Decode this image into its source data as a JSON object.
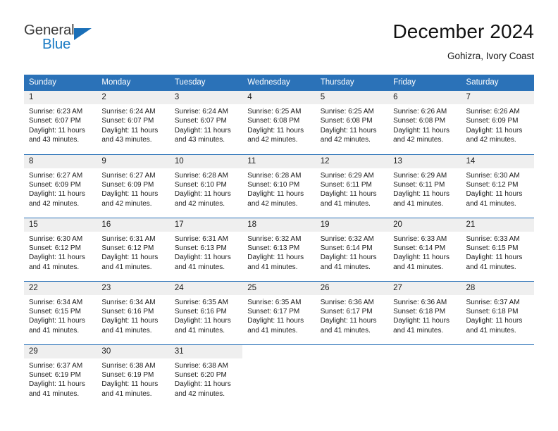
{
  "logo": {
    "word1": "General",
    "word2": "Blue",
    "triangle_color": "#1a6fb8"
  },
  "header": {
    "title": "December 2024",
    "subtitle": "Gohizra, Ivory Coast"
  },
  "theme": {
    "header_bg": "#2b72b8",
    "daynum_bg": "#efefef",
    "text": "#1b1b1b"
  },
  "calendar": {
    "weekday_headers": [
      "Sunday",
      "Monday",
      "Tuesday",
      "Wednesday",
      "Thursday",
      "Friday",
      "Saturday"
    ],
    "weeks": [
      [
        {
          "day": "1",
          "sunrise": "Sunrise: 6:23 AM",
          "sunset": "Sunset: 6:07 PM",
          "daylight1": "Daylight: 11 hours",
          "daylight2": "and 43 minutes."
        },
        {
          "day": "2",
          "sunrise": "Sunrise: 6:24 AM",
          "sunset": "Sunset: 6:07 PM",
          "daylight1": "Daylight: 11 hours",
          "daylight2": "and 43 minutes."
        },
        {
          "day": "3",
          "sunrise": "Sunrise: 6:24 AM",
          "sunset": "Sunset: 6:07 PM",
          "daylight1": "Daylight: 11 hours",
          "daylight2": "and 43 minutes."
        },
        {
          "day": "4",
          "sunrise": "Sunrise: 6:25 AM",
          "sunset": "Sunset: 6:08 PM",
          "daylight1": "Daylight: 11 hours",
          "daylight2": "and 42 minutes."
        },
        {
          "day": "5",
          "sunrise": "Sunrise: 6:25 AM",
          "sunset": "Sunset: 6:08 PM",
          "daylight1": "Daylight: 11 hours",
          "daylight2": "and 42 minutes."
        },
        {
          "day": "6",
          "sunrise": "Sunrise: 6:26 AM",
          "sunset": "Sunset: 6:08 PM",
          "daylight1": "Daylight: 11 hours",
          "daylight2": "and 42 minutes."
        },
        {
          "day": "7",
          "sunrise": "Sunrise: 6:26 AM",
          "sunset": "Sunset: 6:09 PM",
          "daylight1": "Daylight: 11 hours",
          "daylight2": "and 42 minutes."
        }
      ],
      [
        {
          "day": "8",
          "sunrise": "Sunrise: 6:27 AM",
          "sunset": "Sunset: 6:09 PM",
          "daylight1": "Daylight: 11 hours",
          "daylight2": "and 42 minutes."
        },
        {
          "day": "9",
          "sunrise": "Sunrise: 6:27 AM",
          "sunset": "Sunset: 6:09 PM",
          "daylight1": "Daylight: 11 hours",
          "daylight2": "and 42 minutes."
        },
        {
          "day": "10",
          "sunrise": "Sunrise: 6:28 AM",
          "sunset": "Sunset: 6:10 PM",
          "daylight1": "Daylight: 11 hours",
          "daylight2": "and 42 minutes."
        },
        {
          "day": "11",
          "sunrise": "Sunrise: 6:28 AM",
          "sunset": "Sunset: 6:10 PM",
          "daylight1": "Daylight: 11 hours",
          "daylight2": "and 42 minutes."
        },
        {
          "day": "12",
          "sunrise": "Sunrise: 6:29 AM",
          "sunset": "Sunset: 6:11 PM",
          "daylight1": "Daylight: 11 hours",
          "daylight2": "and 41 minutes."
        },
        {
          "day": "13",
          "sunrise": "Sunrise: 6:29 AM",
          "sunset": "Sunset: 6:11 PM",
          "daylight1": "Daylight: 11 hours",
          "daylight2": "and 41 minutes."
        },
        {
          "day": "14",
          "sunrise": "Sunrise: 6:30 AM",
          "sunset": "Sunset: 6:12 PM",
          "daylight1": "Daylight: 11 hours",
          "daylight2": "and 41 minutes."
        }
      ],
      [
        {
          "day": "15",
          "sunrise": "Sunrise: 6:30 AM",
          "sunset": "Sunset: 6:12 PM",
          "daylight1": "Daylight: 11 hours",
          "daylight2": "and 41 minutes."
        },
        {
          "day": "16",
          "sunrise": "Sunrise: 6:31 AM",
          "sunset": "Sunset: 6:12 PM",
          "daylight1": "Daylight: 11 hours",
          "daylight2": "and 41 minutes."
        },
        {
          "day": "17",
          "sunrise": "Sunrise: 6:31 AM",
          "sunset": "Sunset: 6:13 PM",
          "daylight1": "Daylight: 11 hours",
          "daylight2": "and 41 minutes."
        },
        {
          "day": "18",
          "sunrise": "Sunrise: 6:32 AM",
          "sunset": "Sunset: 6:13 PM",
          "daylight1": "Daylight: 11 hours",
          "daylight2": "and 41 minutes."
        },
        {
          "day": "19",
          "sunrise": "Sunrise: 6:32 AM",
          "sunset": "Sunset: 6:14 PM",
          "daylight1": "Daylight: 11 hours",
          "daylight2": "and 41 minutes."
        },
        {
          "day": "20",
          "sunrise": "Sunrise: 6:33 AM",
          "sunset": "Sunset: 6:14 PM",
          "daylight1": "Daylight: 11 hours",
          "daylight2": "and 41 minutes."
        },
        {
          "day": "21",
          "sunrise": "Sunrise: 6:33 AM",
          "sunset": "Sunset: 6:15 PM",
          "daylight1": "Daylight: 11 hours",
          "daylight2": "and 41 minutes."
        }
      ],
      [
        {
          "day": "22",
          "sunrise": "Sunrise: 6:34 AM",
          "sunset": "Sunset: 6:15 PM",
          "daylight1": "Daylight: 11 hours",
          "daylight2": "and 41 minutes."
        },
        {
          "day": "23",
          "sunrise": "Sunrise: 6:34 AM",
          "sunset": "Sunset: 6:16 PM",
          "daylight1": "Daylight: 11 hours",
          "daylight2": "and 41 minutes."
        },
        {
          "day": "24",
          "sunrise": "Sunrise: 6:35 AM",
          "sunset": "Sunset: 6:16 PM",
          "daylight1": "Daylight: 11 hours",
          "daylight2": "and 41 minutes."
        },
        {
          "day": "25",
          "sunrise": "Sunrise: 6:35 AM",
          "sunset": "Sunset: 6:17 PM",
          "daylight1": "Daylight: 11 hours",
          "daylight2": "and 41 minutes."
        },
        {
          "day": "26",
          "sunrise": "Sunrise: 6:36 AM",
          "sunset": "Sunset: 6:17 PM",
          "daylight1": "Daylight: 11 hours",
          "daylight2": "and 41 minutes."
        },
        {
          "day": "27",
          "sunrise": "Sunrise: 6:36 AM",
          "sunset": "Sunset: 6:18 PM",
          "daylight1": "Daylight: 11 hours",
          "daylight2": "and 41 minutes."
        },
        {
          "day": "28",
          "sunrise": "Sunrise: 6:37 AM",
          "sunset": "Sunset: 6:18 PM",
          "daylight1": "Daylight: 11 hours",
          "daylight2": "and 41 minutes."
        }
      ],
      [
        {
          "day": "29",
          "sunrise": "Sunrise: 6:37 AM",
          "sunset": "Sunset: 6:19 PM",
          "daylight1": "Daylight: 11 hours",
          "daylight2": "and 41 minutes."
        },
        {
          "day": "30",
          "sunrise": "Sunrise: 6:38 AM",
          "sunset": "Sunset: 6:19 PM",
          "daylight1": "Daylight: 11 hours",
          "daylight2": "and 41 minutes."
        },
        {
          "day": "31",
          "sunrise": "Sunrise: 6:38 AM",
          "sunset": "Sunset: 6:20 PM",
          "daylight1": "Daylight: 11 hours",
          "daylight2": "and 42 minutes."
        },
        {
          "day": "",
          "sunrise": "",
          "sunset": "",
          "daylight1": "",
          "daylight2": ""
        },
        {
          "day": "",
          "sunrise": "",
          "sunset": "",
          "daylight1": "",
          "daylight2": ""
        },
        {
          "day": "",
          "sunrise": "",
          "sunset": "",
          "daylight1": "",
          "daylight2": ""
        },
        {
          "day": "",
          "sunrise": "",
          "sunset": "",
          "daylight1": "",
          "daylight2": ""
        }
      ]
    ]
  }
}
